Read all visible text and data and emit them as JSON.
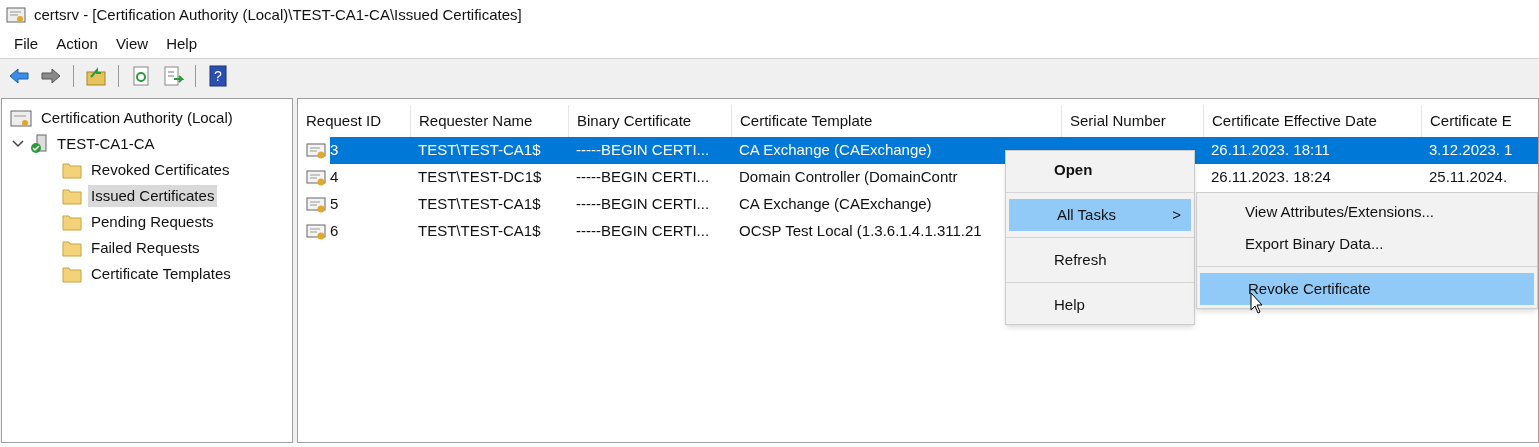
{
  "window": {
    "title": "certsrv - [Certification Authority (Local)\\TEST-CA1-CA\\Issued Certificates]"
  },
  "menu_bar": [
    "File",
    "Action",
    "View",
    "Help"
  ],
  "toolbar": [
    {
      "kind": "back"
    },
    {
      "kind": "forward"
    },
    {
      "kind": "sep"
    },
    {
      "kind": "up"
    },
    {
      "kind": "sep"
    },
    {
      "kind": "refresh"
    },
    {
      "kind": "export"
    },
    {
      "kind": "sep"
    },
    {
      "kind": "help",
      "glyph": "?"
    }
  ],
  "tree": {
    "label": "Certification Authority (Local)",
    "selected": false,
    "children": [
      {
        "label": "TEST-CA1-CA",
        "expanded": true,
        "selected": false,
        "children": [
          {
            "label": "Revoked Certificates",
            "selected": false
          },
          {
            "label": "Issued Certificates",
            "selected": true
          },
          {
            "label": "Pending Requests",
            "selected": false
          },
          {
            "label": "Failed Requests",
            "selected": false
          },
          {
            "label": "Certificate Templates",
            "selected": false
          }
        ]
      }
    ]
  },
  "table": {
    "columns": [
      "Request ID",
      "Requester Name",
      "Binary Certificate",
      "Certificate Template",
      "Serial Number",
      "Certificate Effective Date",
      "Certificate E"
    ],
    "rows": [
      {
        "selected": true,
        "cells": [
          "3",
          "TEST\\TEST-CA1$",
          "-----BEGIN CERTI...",
          "CA Exchange (CAExchange)",
          "",
          "26.11.2023. 18:11",
          "3.12.2023. 1"
        ]
      },
      {
        "selected": false,
        "cells": [
          "4",
          "TEST\\TEST-DC1$",
          "-----BEGIN CERTI...",
          "Domain Controller (DomainContr",
          "",
          "26.11.2023. 18:24",
          "25.11.2024."
        ]
      },
      {
        "selected": false,
        "cells": [
          "5",
          "TEST\\TEST-CA1$",
          "-----BEGIN CERTI...",
          "CA Exchange (CAExchange)",
          "",
          "",
          ""
        ]
      },
      {
        "selected": false,
        "cells": [
          "6",
          "TEST\\TEST-CA1$",
          "-----BEGIN CERTI...",
          "OCSP Test Local (1.3.6.1.4.1.311.21",
          "",
          "",
          ""
        ]
      }
    ]
  },
  "context_menu": {
    "items": [
      {
        "kind": "item",
        "label": "Open",
        "bold": true,
        "selected": false
      },
      {
        "kind": "sep"
      },
      {
        "kind": "submenu",
        "label": "All Tasks",
        "arrow": ">",
        "selected": true
      },
      {
        "kind": "sep"
      },
      {
        "kind": "item",
        "label": "Refresh",
        "bold": false,
        "selected": false
      },
      {
        "kind": "sep"
      },
      {
        "kind": "item",
        "label": "Help",
        "bold": false,
        "selected": false
      }
    ]
  },
  "submenu": {
    "items": [
      {
        "kind": "item",
        "label": "View Attributes/Extensions...",
        "selected": false
      },
      {
        "kind": "item",
        "label": "Export Binary Data...",
        "selected": false
      },
      {
        "kind": "sep"
      },
      {
        "kind": "item",
        "label": "Revoke Certificate",
        "selected": true
      }
    ]
  }
}
